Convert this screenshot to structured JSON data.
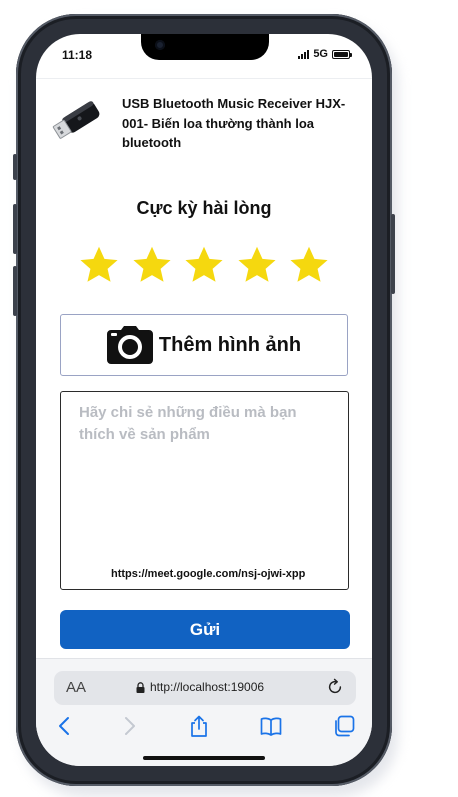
{
  "status": {
    "time": "11:18",
    "network": "5G"
  },
  "product": {
    "name": "USB Bluetooth Music Receiver HJX-001- Biến loa thường thành loa bluetooth",
    "image_icon": "usb-bluetooth-dongle-icon"
  },
  "rating": {
    "label": "Cực kỳ hài lòng",
    "value": 5,
    "max": 5,
    "star_color": "#f5d80f"
  },
  "add_photo": {
    "label": "Thêm hình ảnh",
    "icon": "camera-icon"
  },
  "review": {
    "placeholder": "Hãy chi sẻ những điều mà bạn thích về sản phẩm",
    "value": "",
    "link_text": "https://meet.google.com/nsj-ojwi-xpp"
  },
  "submit": {
    "label": "Gửi",
    "color": "#1162c2"
  },
  "browser": {
    "text_size_label": "AA",
    "url": "http://localhost:19006",
    "accent": "#1a73e8"
  }
}
